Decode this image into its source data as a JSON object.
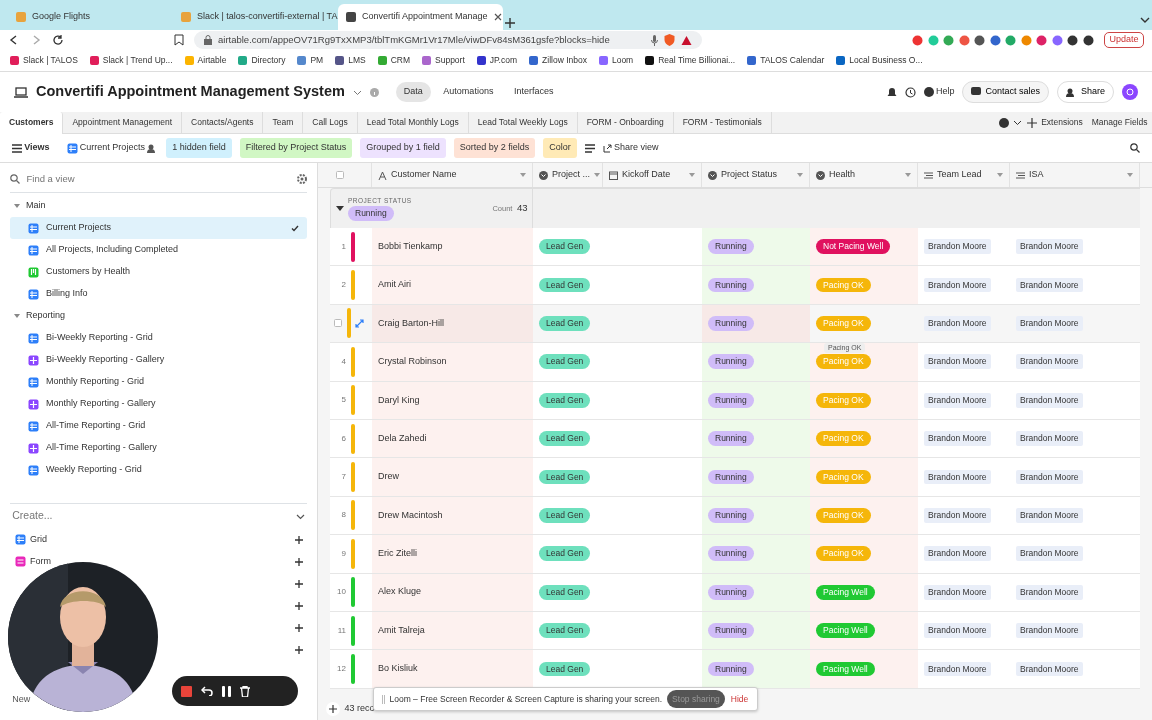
{
  "browser": {
    "tabs": [
      {
        "title": "Google Flights",
        "selected": false
      },
      {
        "title": "Slack | talos-convertifi-external | TA",
        "selected": false
      },
      {
        "title": "Convertifi Appointment Manage",
        "selected": true
      }
    ],
    "url": "airtable.com/appeOV71Rg9TxXMP3/tblTmKGMr1Vr17Mle/viwDFv84sM361gsfe?blocks=hide",
    "update_button": "Update",
    "bookmarks": [
      "Slack | TALOS",
      "Slack | Trend Up...",
      "Airtable",
      "Directory",
      "PM",
      "LMS",
      "CRM",
      "Support",
      "JP.com",
      "Zillow Inbox",
      "Loom",
      "Real Time Billionai...",
      "TALOS Calendar",
      "Local Business O..."
    ]
  },
  "app": {
    "base_title": "Convertifi Appointment Management System",
    "nav": [
      {
        "label": "Data",
        "selected": true
      },
      {
        "label": "Automations",
        "selected": false
      },
      {
        "label": "Interfaces",
        "selected": false
      }
    ],
    "help": "Help",
    "contact_sales": "Contact sales",
    "share": "Share"
  },
  "table_tabs": [
    {
      "label": "Customers",
      "selected": true
    },
    {
      "label": "Appointment Management",
      "selected": false
    },
    {
      "label": "Contacts/Agents",
      "selected": false
    },
    {
      "label": "Team",
      "selected": false
    },
    {
      "label": "Call Logs",
      "selected": false
    },
    {
      "label": "Lead Total Monthly Logs",
      "selected": false
    },
    {
      "label": "Lead Total Weekly Logs",
      "selected": false
    },
    {
      "label": "FORM - Onboarding",
      "selected": false
    },
    {
      "label": "FORM - Testimonials",
      "selected": false
    }
  ],
  "table_actions": [
    "Extensions",
    "Manage Fields"
  ],
  "view_bar": {
    "views": "Views",
    "current_view": "Current Projects",
    "chips": [
      {
        "label": "1 hidden field",
        "color": "#d0f0fd"
      },
      {
        "label": "Filtered by Project Status",
        "color": "#d1f7c4"
      },
      {
        "label": "Grouped by 1 field",
        "color": "#ede2fe"
      },
      {
        "label": "Sorted by 2 fields",
        "color": "#fee2d5"
      },
      {
        "label": "Color",
        "color": "#ffeab6"
      }
    ],
    "share_view": "Share view"
  },
  "sidebar": {
    "search_placeholder": "Find a view",
    "sections": [
      {
        "title": "Main",
        "items": [
          {
            "label": "Current Projects",
            "kind": "grid",
            "selected": true
          },
          {
            "label": "All Projects, Including Completed",
            "kind": "grid",
            "selected": false
          },
          {
            "label": "Customers by Health",
            "kind": "kanban",
            "selected": false
          },
          {
            "label": "Billing Info",
            "kind": "grid",
            "selected": false
          }
        ]
      },
      {
        "title": "Reporting",
        "items": [
          {
            "label": "Bi-Weekly Reporting - Grid",
            "kind": "grid",
            "selected": false
          },
          {
            "label": "Bi-Weekly Reporting - Gallery",
            "kind": "gallery",
            "selected": false
          },
          {
            "label": "Monthly Reporting - Grid",
            "kind": "grid",
            "selected": false
          },
          {
            "label": "Monthly Reporting - Gallery",
            "kind": "gallery",
            "selected": false
          },
          {
            "label": "All-Time Reporting - Grid",
            "kind": "grid",
            "selected": false
          },
          {
            "label": "All-Time Reporting - Gallery",
            "kind": "gallery",
            "selected": false
          },
          {
            "label": "Weekly Reporting - Grid",
            "kind": "grid",
            "selected": false
          }
        ]
      }
    ],
    "create_title": "Create...",
    "create_items": [
      {
        "label": "Grid",
        "kind": "grid"
      },
      {
        "label": "Form",
        "kind": "form"
      }
    ],
    "new_label": "New"
  },
  "table": {
    "columns": [
      {
        "label": "Customer Name",
        "kind": "text"
      },
      {
        "label": "Project ...",
        "kind": "select"
      },
      {
        "label": "Kickoff Date",
        "kind": "date"
      },
      {
        "label": "Project Status",
        "kind": "select"
      },
      {
        "label": "Health",
        "kind": "select"
      },
      {
        "label": "Team Lead",
        "kind": "link"
      },
      {
        "label": "ISA",
        "kind": "link"
      }
    ],
    "group": {
      "field": "PROJECT STATUS",
      "value": "Running",
      "count_label": "Count",
      "count": "43"
    },
    "rows": [
      {
        "number": "1",
        "name": "Bobbi Tienkamp",
        "type": "Lead Gen",
        "status": "Running",
        "health": "Not Pacing Well",
        "color": "#e0115f",
        "team_lead": "Brandon Moore",
        "isa": "Brandon Moore",
        "hovered": false
      },
      {
        "number": "2",
        "name": "Amit Airi",
        "type": "Lead Gen",
        "status": "Running",
        "health": "Pacing OK",
        "color": "#f5b60a",
        "team_lead": "Brandon Moore",
        "isa": "Brandon Moore",
        "hovered": false
      },
      {
        "name": "Craig Barton-Hill",
        "type": "Lead Gen",
        "status": "Running",
        "health": "Pacing OK",
        "color": "#f5b60a",
        "team_lead": "Brandon Moore",
        "isa": "Brandon Moore",
        "hovered": true
      },
      {
        "number": "4",
        "name": "Crystal Robinson",
        "type": "Lead Gen",
        "status": "Running",
        "health": "Pacing OK",
        "color": "#f5b60a",
        "team_lead": "Brandon Moore",
        "isa": "Brandon Moore",
        "hovered": false
      },
      {
        "number": "5",
        "name": "Daryl King",
        "type": "Lead Gen",
        "status": "Running",
        "health": "Pacing OK",
        "color": "#f5b60a",
        "team_lead": "Brandon Moore",
        "isa": "Brandon Moore",
        "hovered": false
      },
      {
        "number": "6",
        "name": "Dela Zahedi",
        "type": "Lead Gen",
        "status": "Running",
        "health": "Pacing OK",
        "color": "#f5b60a",
        "team_lead": "Brandon Moore",
        "isa": "Brandon Moore",
        "hovered": false
      },
      {
        "number": "7",
        "name": "Drew",
        "type": "Lead Gen",
        "status": "Running",
        "health": "Pacing OK",
        "color": "#f5b60a",
        "team_lead": "Brandon Moore",
        "isa": "Brandon Moore",
        "hovered": false
      },
      {
        "number": "8",
        "name": "Drew Macintosh",
        "type": "Lead Gen",
        "status": "Running",
        "health": "Pacing OK",
        "color": "#f5b60a",
        "team_lead": "Brandon Moore",
        "isa": "Brandon Moore",
        "hovered": false
      },
      {
        "number": "9",
        "name": "Eric Zitelli",
        "type": "Lead Gen",
        "status": "Running",
        "health": "Pacing OK",
        "color": "#f5b60a",
        "team_lead": "Brandon Moore",
        "isa": "Brandon Moore",
        "hovered": false
      },
      {
        "number": "10",
        "name": "Alex Kluge",
        "type": "Lead Gen",
        "status": "Running",
        "health": "Pacing Well",
        "color": "#20c933",
        "team_lead": "Brandon Moore",
        "isa": "Brandon Moore",
        "hovered": false
      },
      {
        "number": "11",
        "name": "Amit Talreja",
        "type": "Lead Gen",
        "status": "Running",
        "health": "Pacing Well",
        "color": "#20c933",
        "team_lead": "Brandon Moore",
        "isa": "Brandon Moore",
        "hovered": false
      },
      {
        "number": "12",
        "name": "Bo Kisliuk",
        "type": "Lead Gen",
        "status": "Running",
        "health": "Pacing Well",
        "color": "#20c933",
        "team_lead": "Brandon Moore",
        "isa": "Brandon Moore",
        "hovered": false
      }
    ],
    "tooltip": "Pacing OK",
    "record_count": "43 reco"
  },
  "loom": {
    "message": "Loom – Free Screen Recorder & Screen Capture is sharing your screen.",
    "stop": "Stop sharing",
    "hide": "Hide"
  },
  "webcam": {
    "kind": "picture"
  }
}
